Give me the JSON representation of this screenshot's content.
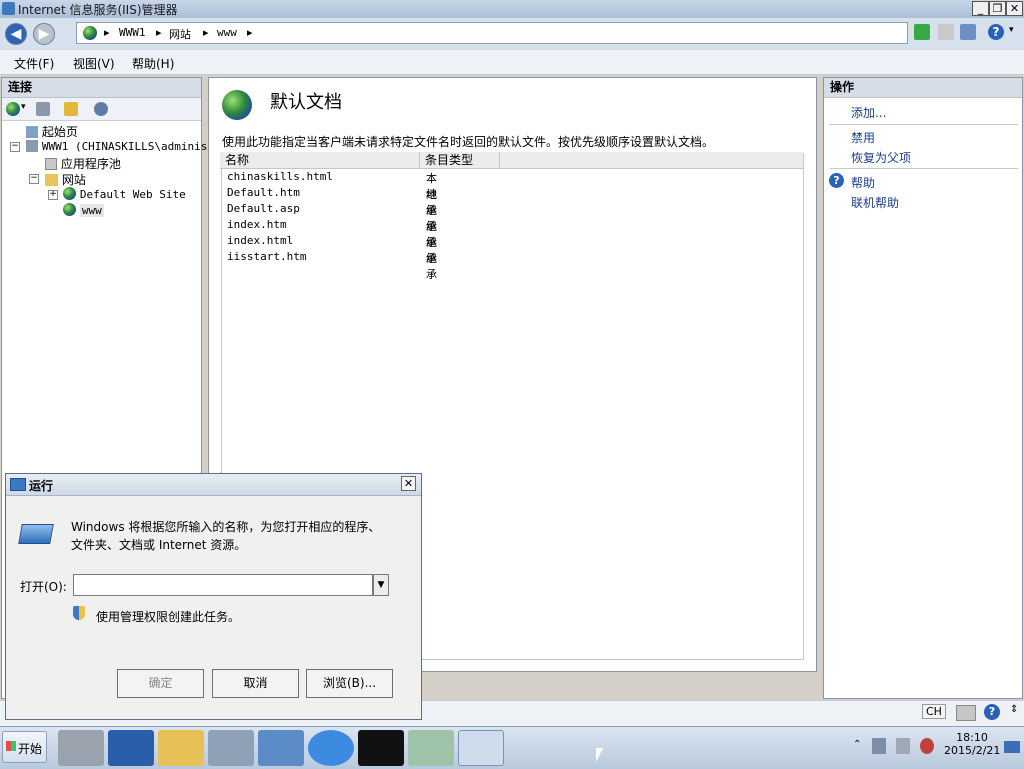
{
  "window": {
    "title": "Internet 信息服务(IIS)管理器",
    "min_label": "_",
    "max_label": "❐",
    "close_label": "✕"
  },
  "address": {
    "seg1": "WWW1",
    "seg2": "网站",
    "seg3": "www",
    "arrow": "▸"
  },
  "menu": {
    "file": "文件(F)",
    "view": "视图(V)",
    "help": "帮助(H)"
  },
  "left_pane": {
    "header": "连接",
    "tree": {
      "start_page": "起始页",
      "server": "WWW1 (CHINASKILLS\\administ",
      "app_pools": "应用程序池",
      "sites": "网站",
      "default_site": "Default Web Site",
      "www": "www"
    }
  },
  "center": {
    "title": "默认文档",
    "description": "使用此功能指定当客户端未请求特定文件名时返回的默认文件。按优先级顺序设置默认文档。",
    "columns": [
      "名称",
      "条目类型"
    ],
    "rows": [
      {
        "name": "chinaskills.html",
        "type": "本地"
      },
      {
        "name": "Default.htm",
        "type": "继承"
      },
      {
        "name": "Default.asp",
        "type": "继承"
      },
      {
        "name": "index.htm",
        "type": "继承"
      },
      {
        "name": "index.html",
        "type": "继承"
      },
      {
        "name": "iisstart.htm",
        "type": "继承"
      }
    ]
  },
  "right_pane": {
    "header": "操作",
    "add": "添加...",
    "disable": "禁用",
    "revert": "恢复为父项",
    "help": "帮助",
    "online_help": "联机帮助"
  },
  "status": {
    "lang": "CH"
  },
  "run_dialog": {
    "title": "运行",
    "description_line1": "Windows 将根据您所输入的名称，为您打开相应的程序、",
    "description_line2": "文件夹、文档或 Internet 资源。",
    "open_label": "打开(O):",
    "open_value": "",
    "admin_note": "使用管理权限创建此任务。",
    "ok": "确定",
    "cancel": "取消",
    "browse": "浏览(B)..."
  },
  "taskbar": {
    "start": "开始",
    "time": "18:10",
    "date": "2015/2/21"
  },
  "colors": {
    "link": "#1c3e8a",
    "pane_header": "#d7dde7"
  }
}
